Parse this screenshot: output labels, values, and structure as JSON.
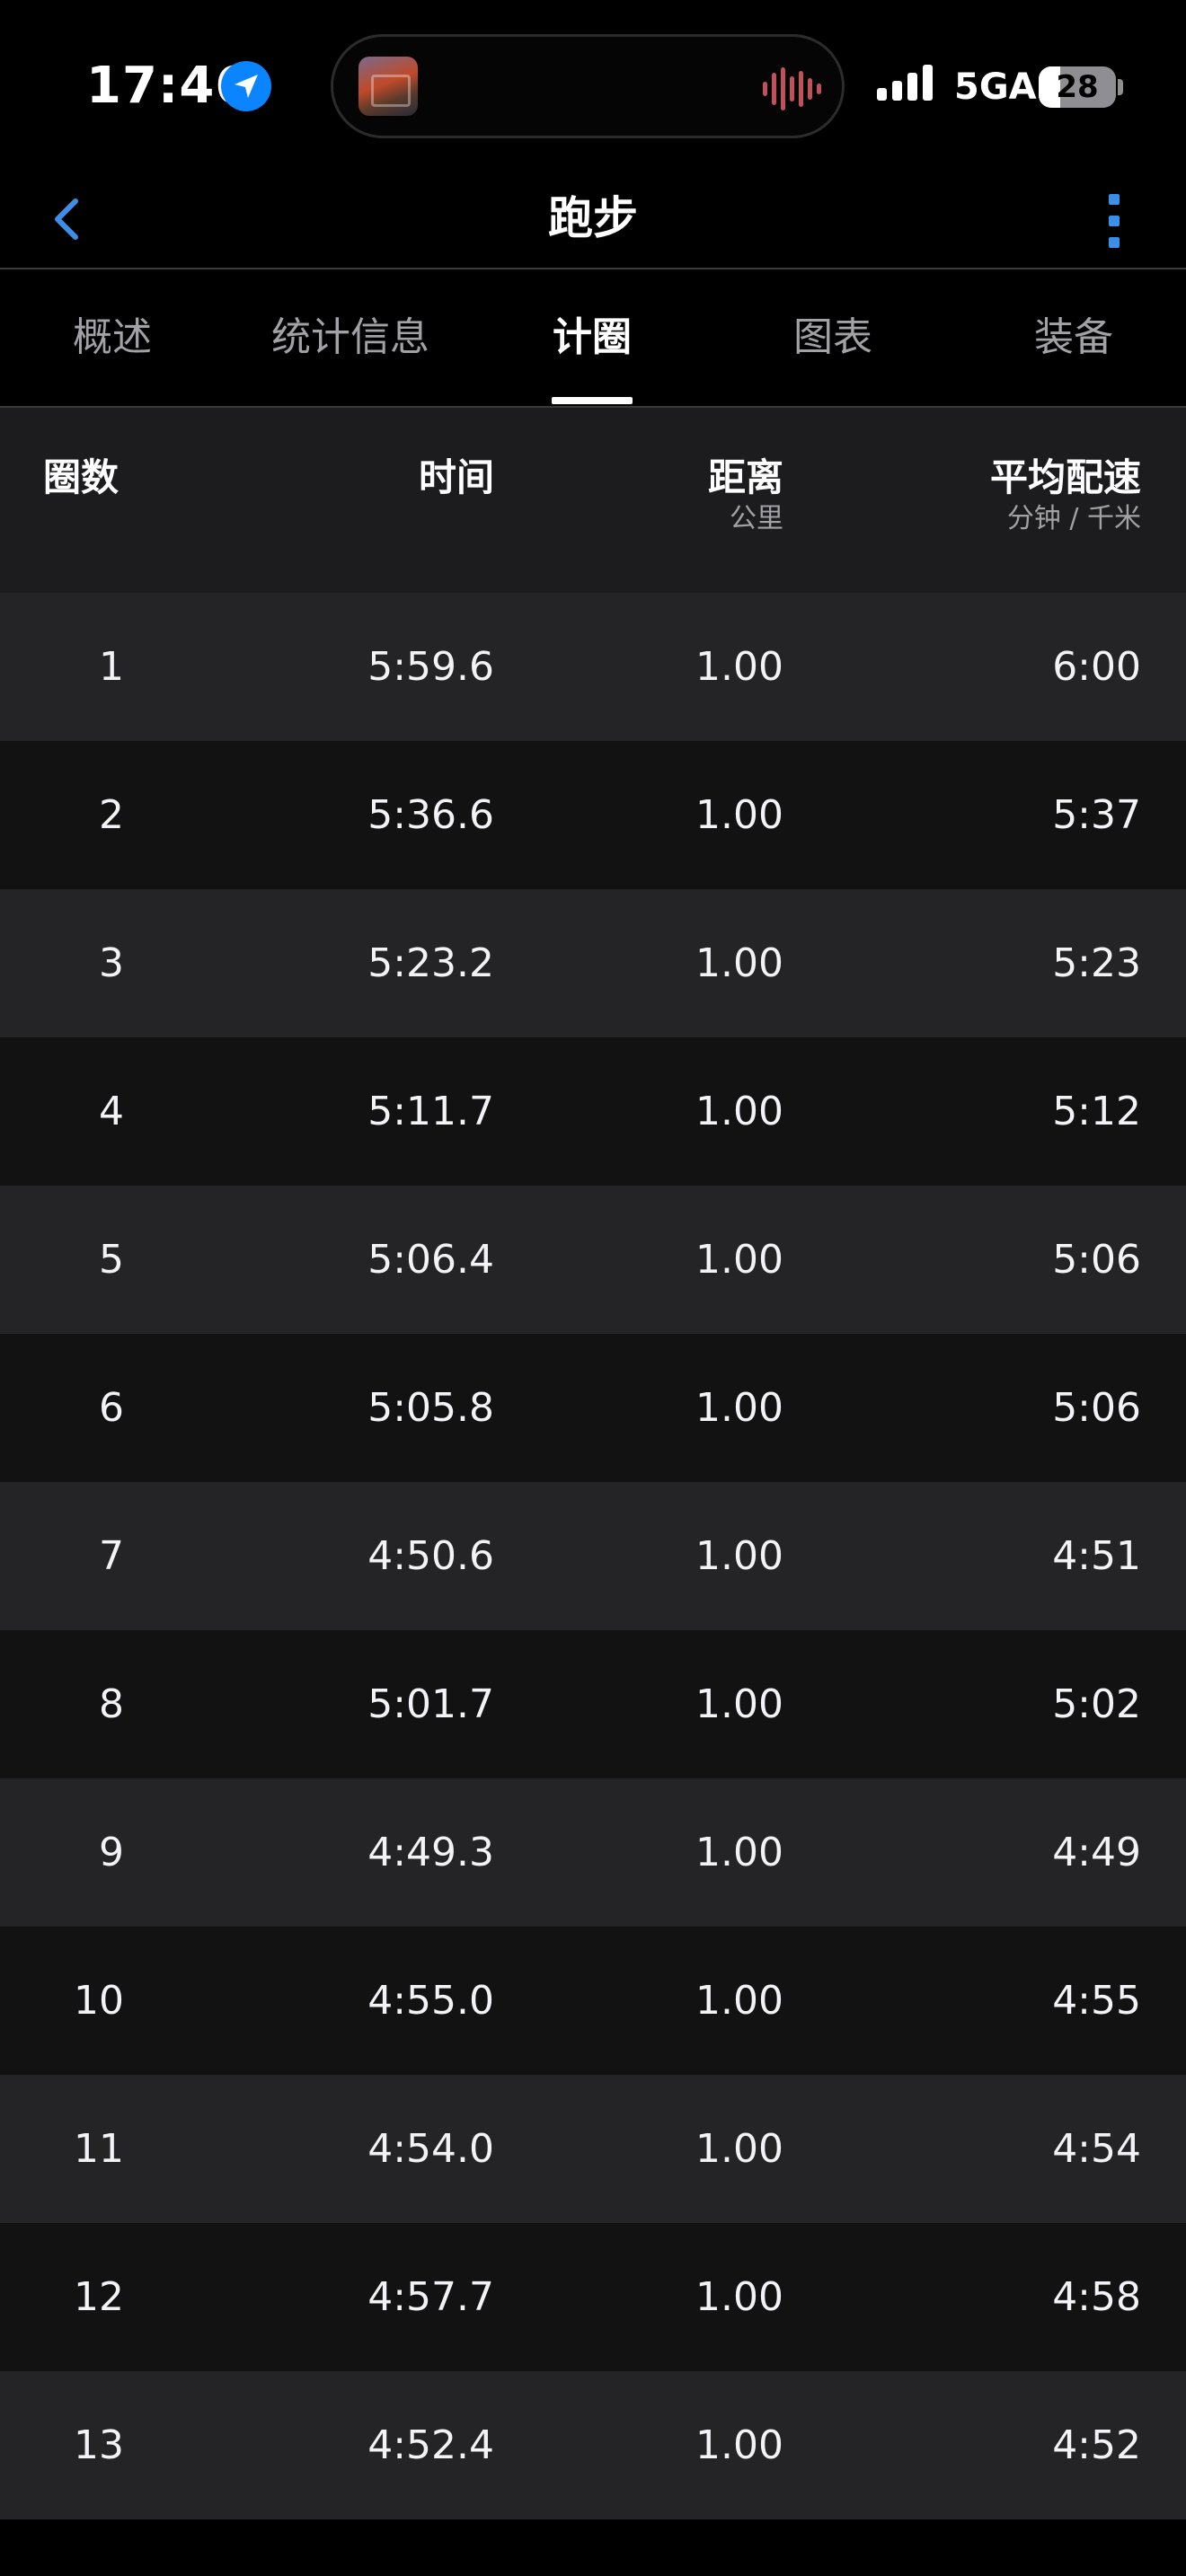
{
  "status_bar": {
    "time": "17:46",
    "network": "5GA",
    "battery": "28",
    "battery_fraction": 0.28,
    "icons": [
      "location-arrow-icon",
      "waveform-icon",
      "signal-bars-icon",
      "battery-icon"
    ]
  },
  "nav": {
    "title": "跑步",
    "back_icon": "chevron-left-icon",
    "more_icon": "more-vertical-icon",
    "accent_color": "#3b8fe8"
  },
  "tabs": [
    {
      "label": "概述",
      "active": false
    },
    {
      "label": "统计信息",
      "active": false
    },
    {
      "label": "计圈",
      "active": true
    },
    {
      "label": "图表",
      "active": false
    },
    {
      "label": "装备",
      "active": false
    }
  ],
  "table": {
    "headers": {
      "lap": "圈数",
      "time": "时间",
      "distance": "距离",
      "distance_unit": "公里",
      "pace": "平均配速",
      "pace_unit": "分钟 / 千米"
    },
    "rows": [
      {
        "lap": "1",
        "time": "5:59.6",
        "distance": "1.00",
        "pace": "6:00"
      },
      {
        "lap": "2",
        "time": "5:36.6",
        "distance": "1.00",
        "pace": "5:37"
      },
      {
        "lap": "3",
        "time": "5:23.2",
        "distance": "1.00",
        "pace": "5:23"
      },
      {
        "lap": "4",
        "time": "5:11.7",
        "distance": "1.00",
        "pace": "5:12"
      },
      {
        "lap": "5",
        "time": "5:06.4",
        "distance": "1.00",
        "pace": "5:06"
      },
      {
        "lap": "6",
        "time": "5:05.8",
        "distance": "1.00",
        "pace": "5:06"
      },
      {
        "lap": "7",
        "time": "4:50.6",
        "distance": "1.00",
        "pace": "4:51"
      },
      {
        "lap": "8",
        "time": "5:01.7",
        "distance": "1.00",
        "pace": "5:02"
      },
      {
        "lap": "9",
        "time": "4:49.3",
        "distance": "1.00",
        "pace": "4:49"
      },
      {
        "lap": "10",
        "time": "4:55.0",
        "distance": "1.00",
        "pace": "4:55"
      },
      {
        "lap": "11",
        "time": "4:54.0",
        "distance": "1.00",
        "pace": "4:54"
      },
      {
        "lap": "12",
        "time": "4:57.7",
        "distance": "1.00",
        "pace": "4:58"
      },
      {
        "lap": "13",
        "time": "4:52.4",
        "distance": "1.00",
        "pace": "4:52"
      }
    ]
  }
}
